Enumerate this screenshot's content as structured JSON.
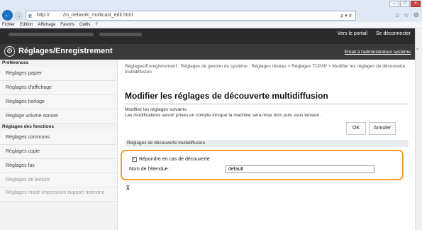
{
  "browser": {
    "address_text": "http://              /m_network_multicast_edit.html",
    "address_tools": "ρ ▾ σ",
    "window_buttons": [
      "–",
      "□",
      "✕"
    ],
    "menu": [
      "Fichier",
      "Edition",
      "Affichage",
      "Favoris",
      "Outils",
      "?"
    ]
  },
  "header": {
    "portal_link": "Vers le portail",
    "logout_link": "Se déconnecter",
    "title": "Réglages/Enregistrement",
    "admin_email": "Email à l'administrateur système"
  },
  "sidebar": {
    "sections": [
      {
        "label": "Préférences",
        "items": [
          "Réglages papier",
          "Réglages d'affichage",
          "Réglages horloge",
          "Réglage volume sonore"
        ]
      },
      {
        "label": "Réglages des fonctions",
        "items": [
          "Réglages communs",
          "Réglages copie",
          "Réglages fax",
          "Réglages de lecture",
          "Réglages mode Impression support mémoire"
        ]
      }
    ]
  },
  "main": {
    "breadcrumb": "Réglages/Enregistrement : Réglages de gestion du système : Réglages réseau > Réglages TCP/IP > Modifier les réglages de découverte multidiffusion",
    "title": "Modifier les réglages de découverte multidiffusion",
    "desc_line1": "Modifiez les réglages suivants.",
    "desc_line2": "Les modifications seront prises en compte lorsque la machine sera mise hors puis sous tension.",
    "ok_label": "OK",
    "cancel_label": "Annuler",
    "section_label": "Réglages de découverte multidiffusion",
    "checkbox_label": "Répondre en cas de découverte",
    "checkbox_checked": true,
    "scope_label": "Nom de l'étendue :",
    "scope_value": "default"
  }
}
